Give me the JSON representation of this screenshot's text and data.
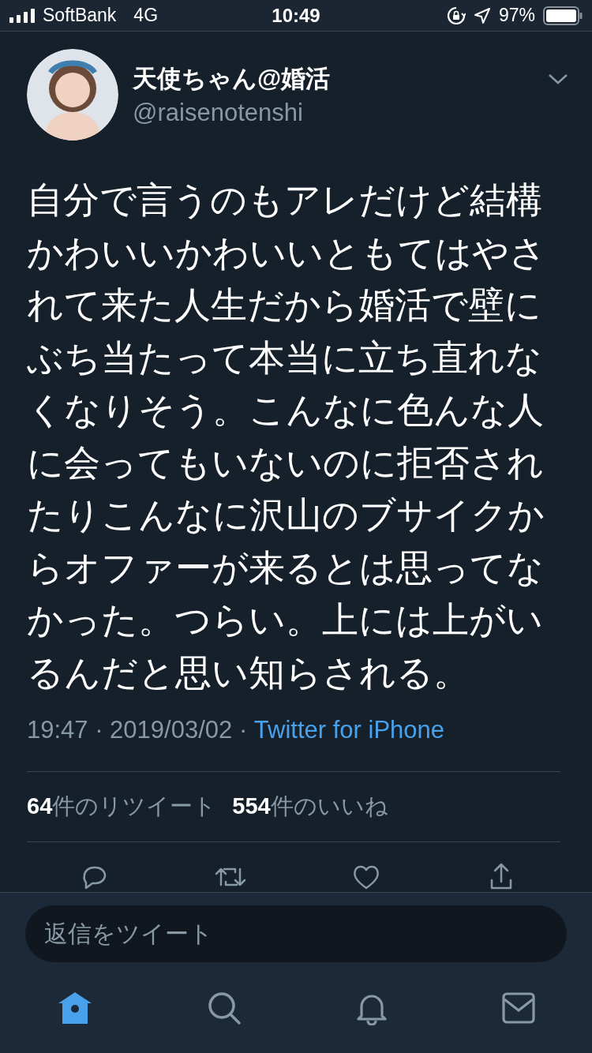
{
  "status_bar": {
    "carrier": "SoftBank",
    "network": "4G",
    "time": "10:49",
    "battery": "97%"
  },
  "tweet": {
    "name": "天使ちゃん@婚活",
    "handle": "@raisenotenshi",
    "text": "自分で言うのもアレだけど結構かわいいかわいいともてはやされて来た人生だから婚活で壁にぶち当たって本当に立ち直れなくなりそう。こんなに色んな人に会ってもいないのに拒否されたりこんなに沢山のブサイクからオファーが来るとは思ってなかった。つらい。上には上がいるんだと思い知らされる。",
    "timestamp": "19:47 · 2019/03/02 · ",
    "source": "Twitter for iPhone",
    "retweet_count": "64",
    "retweet_label": "件のリツイート",
    "like_count": "554",
    "like_label": "件のいいね"
  },
  "reply": {
    "placeholder": "返信をツイート"
  },
  "tabs": [
    {
      "kind": "home",
      "selected": true
    },
    {
      "kind": "search",
      "selected": false
    },
    {
      "kind": "notifications",
      "selected": false
    },
    {
      "kind": "messages",
      "selected": false
    }
  ]
}
